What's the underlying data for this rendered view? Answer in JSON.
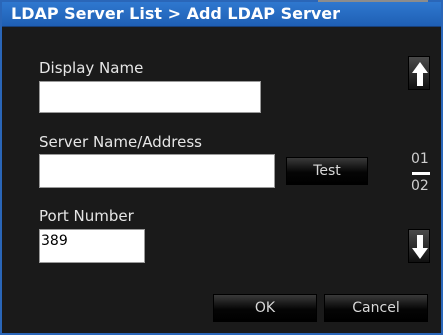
{
  "dialog": {
    "title": "LDAP Server List > Add LDAP Server"
  },
  "form": {
    "display_name_label": "Display Name",
    "display_name_value": "",
    "server_label": "Server Name/Address",
    "server_value": "",
    "port_label": "Port Number",
    "port_value": "389"
  },
  "buttons": {
    "test": "Test",
    "ok": "OK",
    "cancel": "Cancel"
  },
  "pager": {
    "current": "01",
    "total": "02"
  },
  "icons": {
    "up": "up-arrow-icon",
    "down": "down-arrow-icon"
  },
  "colors": {
    "title_bg": "#2a6cc6",
    "body_bg": "#1a1a1a",
    "frame_border": "#2a66b8"
  }
}
